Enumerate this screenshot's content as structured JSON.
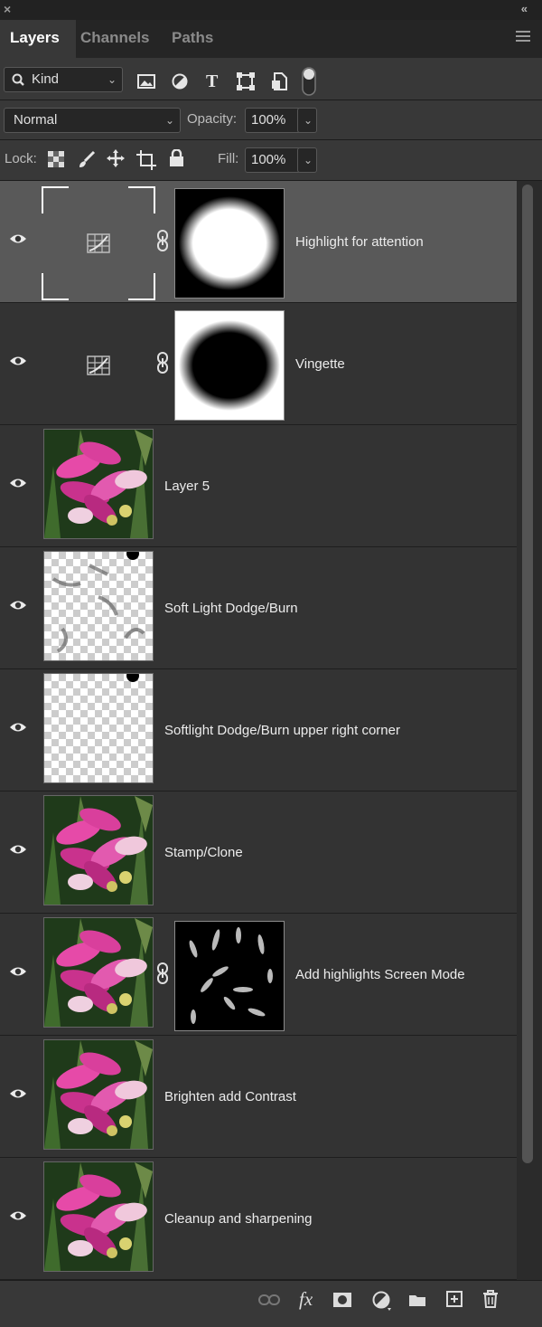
{
  "window": {
    "close_glyph": "×",
    "collapse_glyph": "«"
  },
  "tabs": [
    {
      "label": "Layers",
      "active": true
    },
    {
      "label": "Channels",
      "active": false
    },
    {
      "label": "Paths",
      "active": false
    }
  ],
  "filter": {
    "kind_label": "Kind",
    "icons": [
      "image-filter-icon",
      "adjustment-filter-icon",
      "type-filter-icon",
      "shape-filter-icon",
      "smart-object-filter-icon",
      "filter-toggle-icon"
    ],
    "type_glyph": "T"
  },
  "blend": {
    "mode": "Normal",
    "opacity_label": "Opacity:",
    "opacity_value": "100%"
  },
  "lock": {
    "label": "Lock:",
    "fill_label": "Fill:",
    "fill_value": "100%",
    "icons": [
      "lock-transparent-pixels-icon",
      "lock-image-pixels-icon",
      "lock-position-icon",
      "lock-artboard-icon",
      "lock-all-icon"
    ]
  },
  "layers": [
    {
      "name": "Highlight for attention",
      "type": "adjustment",
      "mask": "white-ellipse",
      "selected": true,
      "visible": true
    },
    {
      "name": "Vingette",
      "type": "adjustment",
      "mask": "black-ellipse",
      "selected": false,
      "visible": true
    },
    {
      "name": "Layer 5",
      "type": "photo",
      "selected": false,
      "visible": true
    },
    {
      "name": "Soft Light Dodge/Burn",
      "type": "transparent-strokes",
      "selected": false,
      "visible": true
    },
    {
      "name": "Softlight Dodge/Burn upper right corner",
      "type": "transparent",
      "selected": false,
      "visible": true
    },
    {
      "name": "Stamp/Clone",
      "type": "photo",
      "selected": false,
      "visible": true
    },
    {
      "name": "Add highlights Screen Mode",
      "type": "photo",
      "mask": "streaks",
      "selected": false,
      "visible": true
    },
    {
      "name": "Brighten add Contrast",
      "type": "photo",
      "selected": false,
      "visible": true
    },
    {
      "name": "Cleanup and sharpening",
      "type": "photo",
      "selected": false,
      "visible": true
    }
  ],
  "bottom_icons": [
    "link-layers-icon",
    "fx-icon",
    "add-mask-icon",
    "new-adjustment-icon",
    "new-group-icon",
    "new-layer-icon",
    "delete-layer-icon"
  ],
  "bottom": {
    "fx_label": "fx"
  },
  "colors": {
    "panel": "#383838",
    "list": "#333333",
    "selected": "#595959",
    "accent": "#d23b9a"
  }
}
